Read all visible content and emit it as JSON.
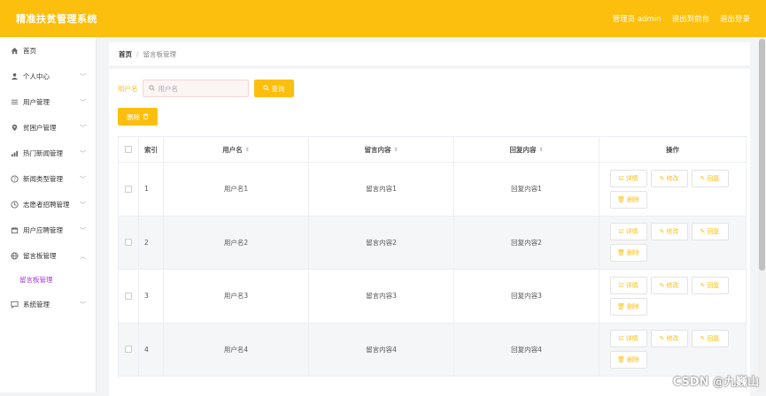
{
  "header": {
    "title": "精准扶贫管理系统",
    "admin_label": "管理员 admin",
    "front_link": "退出到前台",
    "logout_link": "退出登录"
  },
  "sidebar": {
    "items": [
      {
        "label": "首页",
        "icon": "home-icon",
        "has_chevron": false
      },
      {
        "label": "个人中心",
        "icon": "user-icon",
        "has_chevron": true
      },
      {
        "label": "用户管理",
        "icon": "list-icon",
        "has_chevron": true
      },
      {
        "label": "贫困户管理",
        "icon": "location-icon",
        "has_chevron": true
      },
      {
        "label": "热门新闻管理",
        "icon": "chart-icon",
        "has_chevron": true
      },
      {
        "label": "新闻类型管理",
        "icon": "help-icon",
        "has_chevron": true
      },
      {
        "label": "志愿者招聘管理",
        "icon": "clock-icon",
        "has_chevron": true
      },
      {
        "label": "用户应聘管理",
        "icon": "calendar-icon",
        "has_chevron": true
      },
      {
        "label": "留言板管理",
        "icon": "globe-icon",
        "has_chevron": true,
        "expanded": true
      },
      {
        "label": "系统管理",
        "icon": "chat-icon",
        "has_chevron": true
      }
    ],
    "active_submenu": "留言板管理"
  },
  "breadcrumb": {
    "home": "首页",
    "separator": "/",
    "current": "留言板管理"
  },
  "search": {
    "label": "用户名",
    "placeholder": "用户名",
    "query_button": "查询"
  },
  "toolbar": {
    "delete_button": "删除"
  },
  "table": {
    "headers": {
      "index": "索引",
      "username": "用户名",
      "message": "留言内容",
      "reply": "回复内容",
      "ops": "操作"
    },
    "rows": [
      {
        "index": "1",
        "username": "用户名1",
        "message": "留言内容1",
        "reply": "回复内容1"
      },
      {
        "index": "2",
        "username": "用户名2",
        "message": "留言内容2",
        "reply": "回复内容2"
      },
      {
        "index": "3",
        "username": "用户名3",
        "message": "留言内容3",
        "reply": "回复内容3"
      },
      {
        "index": "4",
        "username": "用户名4",
        "message": "留言内容4",
        "reply": "回复内容4"
      }
    ],
    "op_labels": {
      "detail": "详情",
      "edit": "修改",
      "reply": "回复",
      "delete": "删除"
    }
  },
  "watermark": "CSDN @九巍山",
  "colors": {
    "accent": "#fcbf0d",
    "active_submenu": "#a23bd6"
  }
}
